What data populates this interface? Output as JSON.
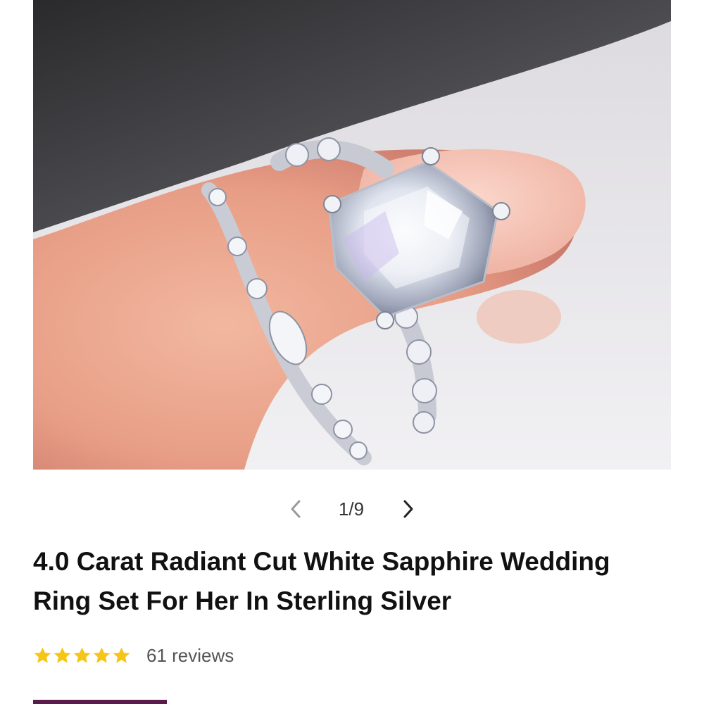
{
  "gallery": {
    "image_alt": "Radiant cut white sapphire engagement ring and matching band worn on a finger",
    "counter": "1/9",
    "prev_icon": "chevron-left-icon",
    "next_icon": "chevron-right-icon"
  },
  "product": {
    "title": "4.0 Carat Radiant Cut White Sapphire Wedding Ring Set For Her In Sterling Silver",
    "rating": 5,
    "rating_max": 5,
    "reviews_label": "61 reviews"
  },
  "colors": {
    "star": "#f5c518",
    "accent": "#5a1a4a",
    "chevron_prev": "#9a9a9a",
    "chevron_next": "#222222"
  }
}
